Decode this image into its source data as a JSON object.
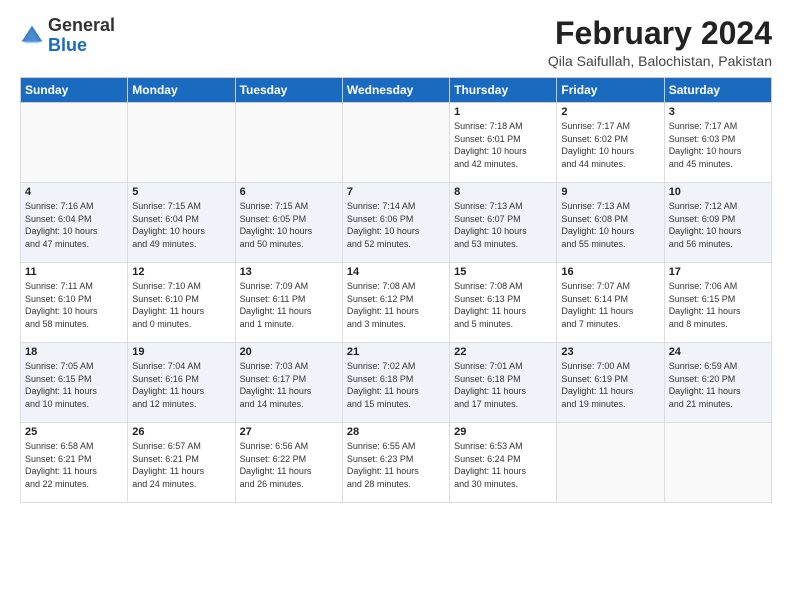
{
  "header": {
    "logo_general": "General",
    "logo_blue": "Blue",
    "month_title": "February 2024",
    "location": "Qila Saifullah, Balochistan, Pakistan"
  },
  "weekdays": [
    "Sunday",
    "Monday",
    "Tuesday",
    "Wednesday",
    "Thursday",
    "Friday",
    "Saturday"
  ],
  "weeks": [
    [
      {
        "day": "",
        "info": ""
      },
      {
        "day": "",
        "info": ""
      },
      {
        "day": "",
        "info": ""
      },
      {
        "day": "",
        "info": ""
      },
      {
        "day": "1",
        "info": "Sunrise: 7:18 AM\nSunset: 6:01 PM\nDaylight: 10 hours\nand 42 minutes."
      },
      {
        "day": "2",
        "info": "Sunrise: 7:17 AM\nSunset: 6:02 PM\nDaylight: 10 hours\nand 44 minutes."
      },
      {
        "day": "3",
        "info": "Sunrise: 7:17 AM\nSunset: 6:03 PM\nDaylight: 10 hours\nand 45 minutes."
      }
    ],
    [
      {
        "day": "4",
        "info": "Sunrise: 7:16 AM\nSunset: 6:04 PM\nDaylight: 10 hours\nand 47 minutes."
      },
      {
        "day": "5",
        "info": "Sunrise: 7:15 AM\nSunset: 6:04 PM\nDaylight: 10 hours\nand 49 minutes."
      },
      {
        "day": "6",
        "info": "Sunrise: 7:15 AM\nSunset: 6:05 PM\nDaylight: 10 hours\nand 50 minutes."
      },
      {
        "day": "7",
        "info": "Sunrise: 7:14 AM\nSunset: 6:06 PM\nDaylight: 10 hours\nand 52 minutes."
      },
      {
        "day": "8",
        "info": "Sunrise: 7:13 AM\nSunset: 6:07 PM\nDaylight: 10 hours\nand 53 minutes."
      },
      {
        "day": "9",
        "info": "Sunrise: 7:13 AM\nSunset: 6:08 PM\nDaylight: 10 hours\nand 55 minutes."
      },
      {
        "day": "10",
        "info": "Sunrise: 7:12 AM\nSunset: 6:09 PM\nDaylight: 10 hours\nand 56 minutes."
      }
    ],
    [
      {
        "day": "11",
        "info": "Sunrise: 7:11 AM\nSunset: 6:10 PM\nDaylight: 10 hours\nand 58 minutes."
      },
      {
        "day": "12",
        "info": "Sunrise: 7:10 AM\nSunset: 6:10 PM\nDaylight: 11 hours\nand 0 minutes."
      },
      {
        "day": "13",
        "info": "Sunrise: 7:09 AM\nSunset: 6:11 PM\nDaylight: 11 hours\nand 1 minute."
      },
      {
        "day": "14",
        "info": "Sunrise: 7:08 AM\nSunset: 6:12 PM\nDaylight: 11 hours\nand 3 minutes."
      },
      {
        "day": "15",
        "info": "Sunrise: 7:08 AM\nSunset: 6:13 PM\nDaylight: 11 hours\nand 5 minutes."
      },
      {
        "day": "16",
        "info": "Sunrise: 7:07 AM\nSunset: 6:14 PM\nDaylight: 11 hours\nand 7 minutes."
      },
      {
        "day": "17",
        "info": "Sunrise: 7:06 AM\nSunset: 6:15 PM\nDaylight: 11 hours\nand 8 minutes."
      }
    ],
    [
      {
        "day": "18",
        "info": "Sunrise: 7:05 AM\nSunset: 6:15 PM\nDaylight: 11 hours\nand 10 minutes."
      },
      {
        "day": "19",
        "info": "Sunrise: 7:04 AM\nSunset: 6:16 PM\nDaylight: 11 hours\nand 12 minutes."
      },
      {
        "day": "20",
        "info": "Sunrise: 7:03 AM\nSunset: 6:17 PM\nDaylight: 11 hours\nand 14 minutes."
      },
      {
        "day": "21",
        "info": "Sunrise: 7:02 AM\nSunset: 6:18 PM\nDaylight: 11 hours\nand 15 minutes."
      },
      {
        "day": "22",
        "info": "Sunrise: 7:01 AM\nSunset: 6:18 PM\nDaylight: 11 hours\nand 17 minutes."
      },
      {
        "day": "23",
        "info": "Sunrise: 7:00 AM\nSunset: 6:19 PM\nDaylight: 11 hours\nand 19 minutes."
      },
      {
        "day": "24",
        "info": "Sunrise: 6:59 AM\nSunset: 6:20 PM\nDaylight: 11 hours\nand 21 minutes."
      }
    ],
    [
      {
        "day": "25",
        "info": "Sunrise: 6:58 AM\nSunset: 6:21 PM\nDaylight: 11 hours\nand 22 minutes."
      },
      {
        "day": "26",
        "info": "Sunrise: 6:57 AM\nSunset: 6:21 PM\nDaylight: 11 hours\nand 24 minutes."
      },
      {
        "day": "27",
        "info": "Sunrise: 6:56 AM\nSunset: 6:22 PM\nDaylight: 11 hours\nand 26 minutes."
      },
      {
        "day": "28",
        "info": "Sunrise: 6:55 AM\nSunset: 6:23 PM\nDaylight: 11 hours\nand 28 minutes."
      },
      {
        "day": "29",
        "info": "Sunrise: 6:53 AM\nSunset: 6:24 PM\nDaylight: 11 hours\nand 30 minutes."
      },
      {
        "day": "",
        "info": ""
      },
      {
        "day": "",
        "info": ""
      }
    ]
  ]
}
